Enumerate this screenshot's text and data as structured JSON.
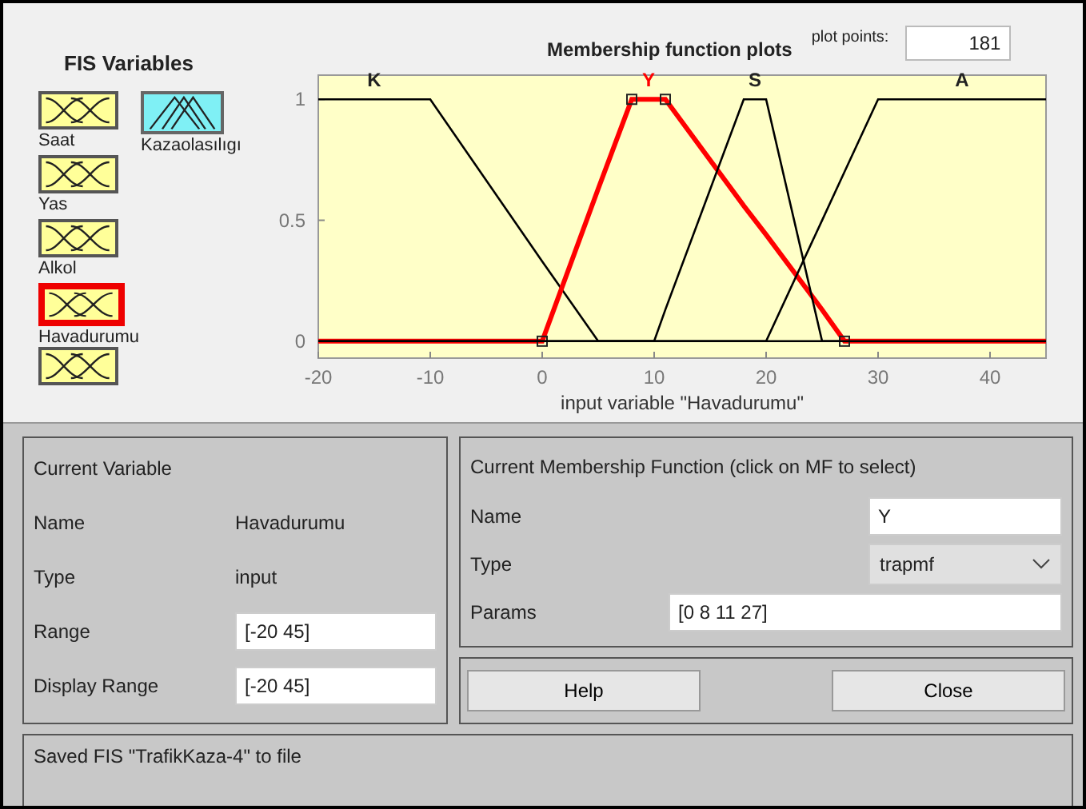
{
  "fis_variables": {
    "title": "FIS Variables",
    "items": [
      {
        "kind": "input",
        "label": "Saat",
        "selected": false
      },
      {
        "kind": "input",
        "label": "Yas",
        "selected": false
      },
      {
        "kind": "input",
        "label": "Alkol",
        "selected": false
      },
      {
        "kind": "input",
        "label": "Havadurumu",
        "selected": true
      },
      {
        "kind": "input",
        "selected": false
      },
      {
        "kind": "output",
        "label": "Kazaolasılıgı",
        "selected": false
      }
    ]
  },
  "plot": {
    "plot_points_label": "plot points:",
    "plot_points": "181",
    "chart_data": {
      "type": "line",
      "title": "Membership function plots",
      "xlabel": "input variable \"Havadurumu\"",
      "x": [
        -20,
        -10,
        0,
        5,
        8,
        10,
        11,
        18,
        20,
        25,
        27,
        30,
        45
      ],
      "series": [
        {
          "name": "K",
          "color": "#000000",
          "values": [
            1,
            1,
            0.33,
            0,
            0,
            0,
            0,
            0,
            0,
            0,
            0,
            0,
            0
          ]
        },
        {
          "name": "Y",
          "color": "#ff0000",
          "values": [
            0,
            0,
            0,
            0.63,
            1,
            1,
            1,
            0.56,
            0.44,
            0.13,
            0,
            0,
            0
          ]
        },
        {
          "name": "S",
          "color": "#000000",
          "values": [
            0,
            0,
            0,
            0,
            0,
            0,
            0.13,
            1,
            1,
            0,
            0,
            0,
            0
          ]
        },
        {
          "name": "A",
          "color": "#000000",
          "values": [
            0,
            0,
            0,
            0,
            0,
            0,
            0,
            0,
            0,
            0.5,
            0.7,
            1,
            1
          ]
        }
      ],
      "xlim": [
        -20,
        45
      ],
      "ylim": [
        -0.07,
        1.1
      ],
      "xticks": [
        -20,
        -10,
        0,
        10,
        20,
        30,
        40
      ],
      "yticks": [
        0,
        0.5,
        1
      ]
    },
    "membership_functions": [
      {
        "selected": false
      },
      {
        "selected": true
      },
      {
        "selected": false
      },
      {
        "selected": false
      }
    ]
  },
  "current_variable": {
    "title": "Current Variable",
    "rows": [
      {
        "kind": "text",
        "label": "Name",
        "value": "Havadurumu"
      },
      {
        "kind": "text",
        "label": "Type",
        "value": "input"
      },
      {
        "kind": "field",
        "label": "Range",
        "value": "[-20 45]"
      },
      {
        "kind": "field",
        "label": "Display Range",
        "value": "[-20 45]"
      }
    ]
  },
  "current_mf": {
    "title": "Current Membership Function (click on MF to select)",
    "name_label": "Name",
    "name": "Y",
    "type_label": "Type",
    "type": "trapmf",
    "params_label": "Params",
    "params": "[0 8 11 27]"
  },
  "buttons": [
    "Help",
    "Close"
  ],
  "status": "Saved FIS \"TrafikKaza-4\" to file"
}
